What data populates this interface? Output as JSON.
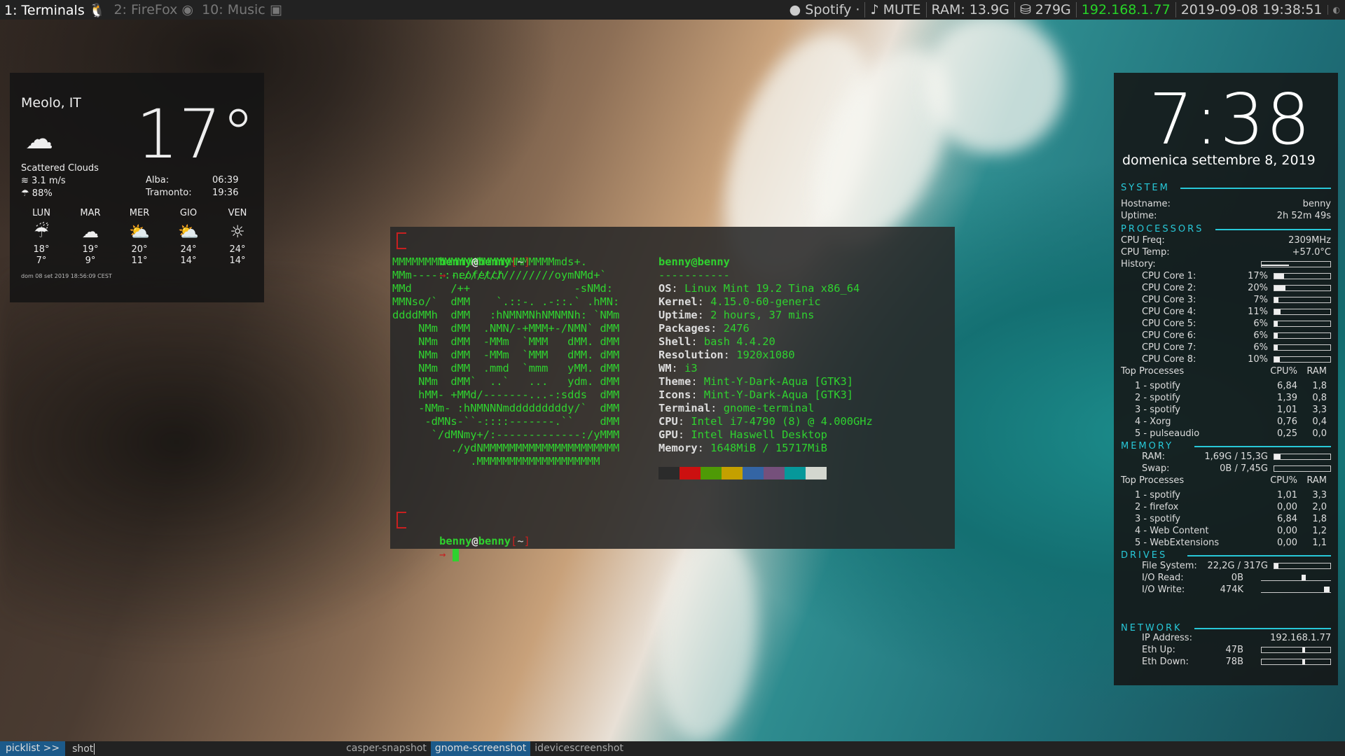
{
  "topbar": {
    "workspaces": [
      {
        "label": "1: Terminals",
        "icon": "linux-penguin-icon",
        "active": true
      },
      {
        "label": "2: FireFox",
        "icon": "firefox-icon",
        "active": false
      },
      {
        "label": "10: Music",
        "icon": "music-app-icon",
        "active": false
      }
    ],
    "spotify": "Spotify ·",
    "audio": "♪ MUTE",
    "ram": "RAM: 13.9G",
    "disk": "279G",
    "ip": "192.168.1.77",
    "datetime": "2019-09-08 19:38:51"
  },
  "weather": {
    "city": "Meolo, IT",
    "temp": "17°",
    "icon": "cloud-icon",
    "description": "Scattered Clouds",
    "wind": "3.1 m/s",
    "humidity": "88%",
    "sunrise_label": "Alba:",
    "sunrise": "06:39",
    "sunset_label": "Tramonto:",
    "sunset": "19:36",
    "forecast": [
      {
        "day": "LUN",
        "icon": "rain-cloud-icon",
        "high": "18°",
        "low": "7°"
      },
      {
        "day": "MAR",
        "icon": "cloud-icon",
        "high": "19°",
        "low": "9°"
      },
      {
        "day": "MER",
        "icon": "sun-cloud-icon",
        "high": "20°",
        "low": "11°"
      },
      {
        "day": "GIO",
        "icon": "sun-cloud-icon",
        "high": "24°",
        "low": "14°"
      },
      {
        "day": "VEN",
        "icon": "sun-icon",
        "high": "24°",
        "low": "14°"
      }
    ],
    "stamp": "dom 08 set 2019 18:56:09 CEST"
  },
  "terminal": {
    "user": "benny",
    "host": "benny",
    "cwd": "~",
    "command": "neofetch",
    "title": "benny@benny",
    "separator": "-----------",
    "art": [
      "MMMMMMMMMMMMMMMMMMMMMMMMMmds+.",
      "MMm----::-://////////////oymNMd+`",
      "MMd      /++                -sNMd:",
      "MMNso/`  dMM    `.::-. .-::.` .hMN:",
      "ddddMMh  dMM   :hNMNMNhNMNMNh: `NMm",
      "    NMm  dMM  .NMN/-+MMM+-/NMN` dMM",
      "    NMm  dMM  -MMm  `MMM   dMM. dMM",
      "    NMm  dMM  -MMm  `MMM   dMM. dMM",
      "    NMm  dMM  .mmd  `mmm   yMM. dMM",
      "    NMm  dMM`  ..`   ...   ydm. dMM",
      "    hMM- +MMd/-------...-:sdds  dMM",
      "    -NMm- :hNMNNNmdddddddddy/`  dMM",
      "     -dMNs-``-::::-------.``    dMM",
      "      `/dMNmy+/:-------------:/yMMM",
      "         ./ydNMMMMMMMMMMMMMMMMMMMMM",
      "            .MMMMMMMMMMMMMMMMMMM"
    ],
    "info": [
      {
        "key": "OS",
        "value": "Linux Mint 19.2 Tina x86_64"
      },
      {
        "key": "Kernel",
        "value": "4.15.0-60-generic"
      },
      {
        "key": "Uptime",
        "value": "2 hours, 37 mins"
      },
      {
        "key": "Packages",
        "value": "2476"
      },
      {
        "key": "Shell",
        "value": "bash 4.4.20"
      },
      {
        "key": "Resolution",
        "value": "1920x1080"
      },
      {
        "key": "WM",
        "value": "i3"
      },
      {
        "key": "Theme",
        "value": "Mint-Y-Dark-Aqua [GTK3]"
      },
      {
        "key": "Icons",
        "value": "Mint-Y-Dark-Aqua [GTK3]"
      },
      {
        "key": "Terminal",
        "value": "gnome-terminal"
      },
      {
        "key": "CPU",
        "value": "Intel i7-4790 (8) @ 4.000GHz"
      },
      {
        "key": "GPU",
        "value": "Intel Haswell Desktop"
      },
      {
        "key": "Memory",
        "value": "1648MiB / 15717MiB"
      }
    ],
    "palette": [
      "#2b2b2b",
      "#cc1010",
      "#4e9a06",
      "#c4a000",
      "#3465a4",
      "#75507b",
      "#06989a",
      "#d3d7cf"
    ]
  },
  "conky": {
    "time": "7:38",
    "date": "domenica settembre  8, 2019",
    "system": {
      "title": "SYSTEM",
      "hostname_label": "Hostname:",
      "hostname": "benny",
      "uptime_label": "Uptime:",
      "uptime": "2h 52m 49s"
    },
    "processors": {
      "title": "PROCESSORS",
      "freq_label": "CPU Freq:",
      "freq": "2309MHz",
      "temp_label": "CPU Temp:",
      "temp": "+57.0°C",
      "history_label": "History:",
      "cores": [
        {
          "label": "CPU Core 1:",
          "value": "17%",
          "pct": 17
        },
        {
          "label": "CPU Core 2:",
          "value": "20%",
          "pct": 20
        },
        {
          "label": "CPU Core 3:",
          "value": "7%",
          "pct": 7
        },
        {
          "label": "CPU Core 4:",
          "value": "11%",
          "pct": 11
        },
        {
          "label": "CPU Core 5:",
          "value": "6%",
          "pct": 6
        },
        {
          "label": "CPU Core 6:",
          "value": "6%",
          "pct": 6
        },
        {
          "label": "CPU Core 7:",
          "value": "6%",
          "pct": 6
        },
        {
          "label": "CPU Core 8:",
          "value": "10%",
          "pct": 10
        }
      ],
      "top_label": "Top Processes",
      "cpu_col": "CPU%",
      "ram_col": "RAM",
      "top": [
        {
          "rank": "1",
          "name": "spotify",
          "cpu": "6,84",
          "ram": "1,8"
        },
        {
          "rank": "2",
          "name": "spotify",
          "cpu": "1,39",
          "ram": "0,8"
        },
        {
          "rank": "3",
          "name": "spotify",
          "cpu": "1,01",
          "ram": "3,3"
        },
        {
          "rank": "4",
          "name": "Xorg",
          "cpu": "0,76",
          "ram": "0,4"
        },
        {
          "rank": "5",
          "name": "pulseaudio",
          "cpu": "0,25",
          "ram": "0,0"
        }
      ]
    },
    "memory": {
      "title": "MEMORY",
      "ram_label": "RAM:",
      "ram": "1,69G / 15,3G",
      "ram_pct": 11,
      "swap_label": "Swap:",
      "swap": "0B / 7,45G",
      "swap_pct": 0,
      "top_label": "Top Processes",
      "cpu_col": "CPU%",
      "ram_col": "RAM",
      "top": [
        {
          "rank": "1",
          "name": "spotify",
          "cpu": "1,01",
          "ram": "3,3"
        },
        {
          "rank": "2",
          "name": "firefox",
          "cpu": "0,00",
          "ram": "2,0"
        },
        {
          "rank": "3",
          "name": "spotify",
          "cpu": "6,84",
          "ram": "1,8"
        },
        {
          "rank": "4",
          "name": "Web Content",
          "cpu": "0,00",
          "ram": "1,2"
        },
        {
          "rank": "5",
          "name": "WebExtensions",
          "cpu": "0,00",
          "ram": "1,1"
        }
      ]
    },
    "drives": {
      "title": "DRIVES",
      "fs_label": "File System:",
      "fs": "22,2G / 317G",
      "fs_pct": 7,
      "read_label": "I/O Read:",
      "read": "0B",
      "write_label": "I/O Write:",
      "write": "474K"
    },
    "network": {
      "title": "NETWORK",
      "ip_label": "IP Address:",
      "ip": "192.168.1.77",
      "up_label": "Eth Up:",
      "up": "47B",
      "down_label": "Eth Down:",
      "down": "78B"
    }
  },
  "bottombar": {
    "prompt": "picklist >>",
    "query": "shot",
    "options": [
      {
        "label": "casper-snapshot",
        "selected": false
      },
      {
        "label": "gnome-screenshot",
        "selected": true
      },
      {
        "label": "idevicescreenshot",
        "selected": false
      }
    ]
  }
}
